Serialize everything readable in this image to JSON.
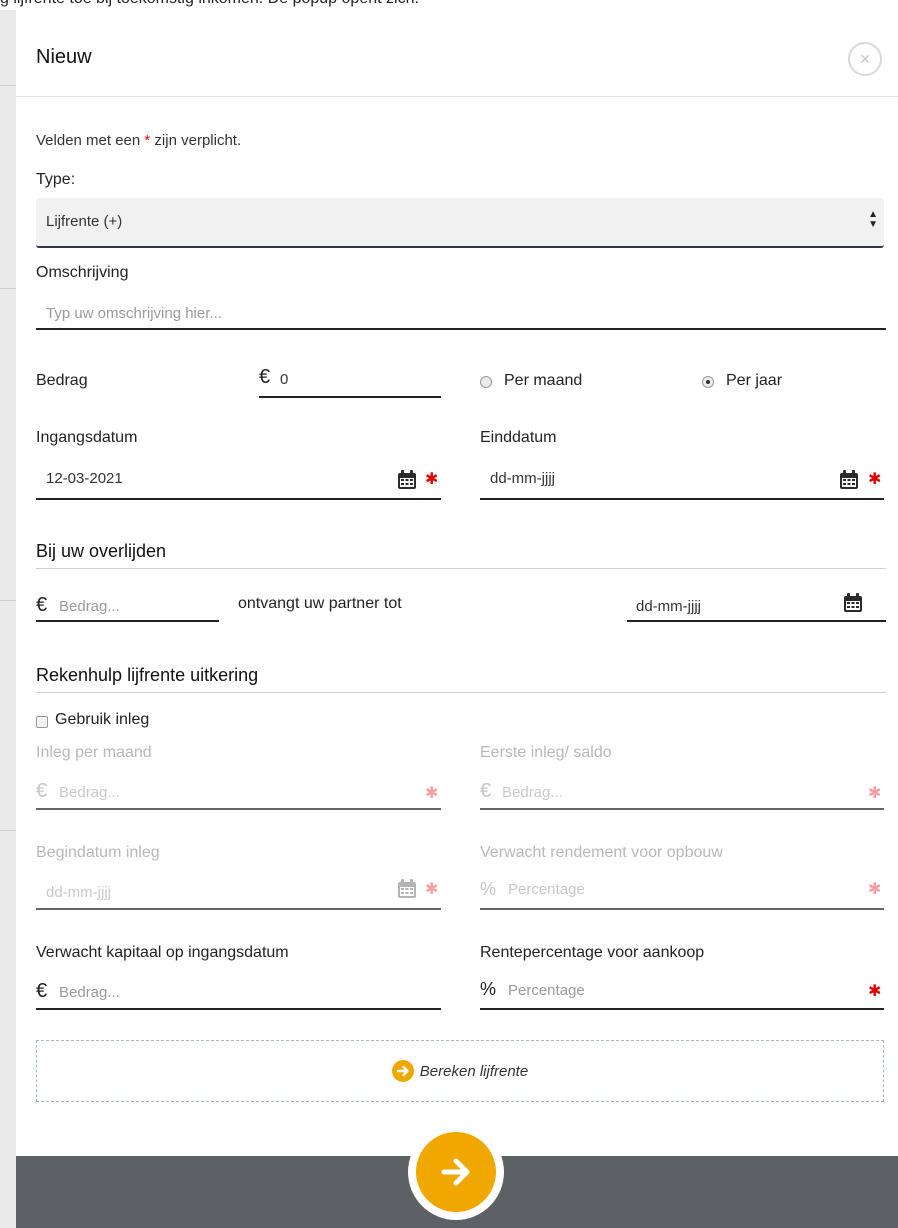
{
  "background": {
    "top_text": "g lijfrente toe bij toekomstig inkomen. De popup opent zich."
  },
  "modal": {
    "title": "Nieuw",
    "close_label": "×"
  },
  "form": {
    "required_note_prefix": "Velden met een ",
    "required_star": "*",
    "required_note_suffix": " zijn verplicht.",
    "type_label": "Type:",
    "type_value": "Lijfrente (+)",
    "omschrijving_label": "Omschrijving",
    "omschrijving_placeholder": "Typ uw omschrijving hier...",
    "bedrag_label": "Bedrag",
    "currency": "€",
    "bedrag_value": "0",
    "per_maand_label": "Per maand",
    "per_jaar_label": "Per jaar",
    "period_selected": "per_jaar",
    "ingangsdatum_label": "Ingangsdatum",
    "ingangsdatum_value": "12-03-2021",
    "einddatum_label": "Einddatum",
    "date_placeholder": "dd-mm-jjjj"
  },
  "overlijden": {
    "title": "Bij uw overlijden",
    "bedrag_placeholder": "Bedrag...",
    "partner_text": "ontvangt uw partner tot",
    "date_placeholder": "dd-mm-jjjj"
  },
  "rekenhulp": {
    "title": "Rekenhulp lijfrente uitkering",
    "checkbox_label": "Gebruik inleg",
    "inleg_label": "Inleg per maand",
    "eerste_inleg_label": "Eerste inleg/ saldo",
    "begindatum_label": "Begindatum inleg",
    "rendement_label": "Verwacht rendement voor opbouw",
    "kapitaal_label": "Verwacht kapitaal op ingangsdatum",
    "rente_label": "Rentepercentage voor aankoop",
    "bedrag_placeholder": "Bedrag...",
    "percentage_placeholder": "Percentage",
    "percent_symbol": "%",
    "date_placeholder": "dd-mm-jjjj",
    "calc_button": "Bereken lijfrente"
  },
  "colors": {
    "accent": "#f0a800",
    "required": "#e00000",
    "overlay": "#5d6166"
  }
}
